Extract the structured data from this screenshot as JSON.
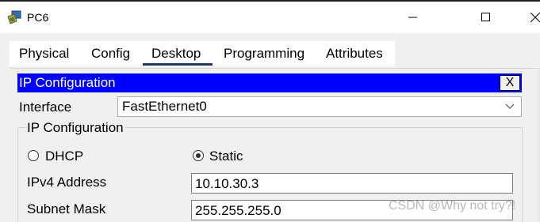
{
  "window": {
    "title": "PC6",
    "icon": "pc-app-icon",
    "controls": [
      "minimize-icon",
      "maximize-icon",
      "close-icon"
    ]
  },
  "tabs": [
    {
      "label": "Physical"
    },
    {
      "label": "Config"
    },
    {
      "label": "Desktop",
      "selected": true
    },
    {
      "label": "Programming"
    },
    {
      "label": "Attributes"
    }
  ],
  "dialog": {
    "title": "IP Configuration",
    "close_label": "X",
    "title_bar_color": "#0000ff",
    "interface_label": "Interface",
    "interface_value": "FastEthernet0",
    "group_title": "IP Configuration",
    "mode": {
      "dhcp_label": "DHCP",
      "static_label": "Static",
      "selected": "Static"
    },
    "ipv4_label": "IPv4 Address",
    "ipv4_value": "10.10.30.3",
    "subnet_label": "Subnet Mask",
    "subnet_value": "255.255.255.0"
  },
  "watermark": "CSDN @Why not try?!"
}
